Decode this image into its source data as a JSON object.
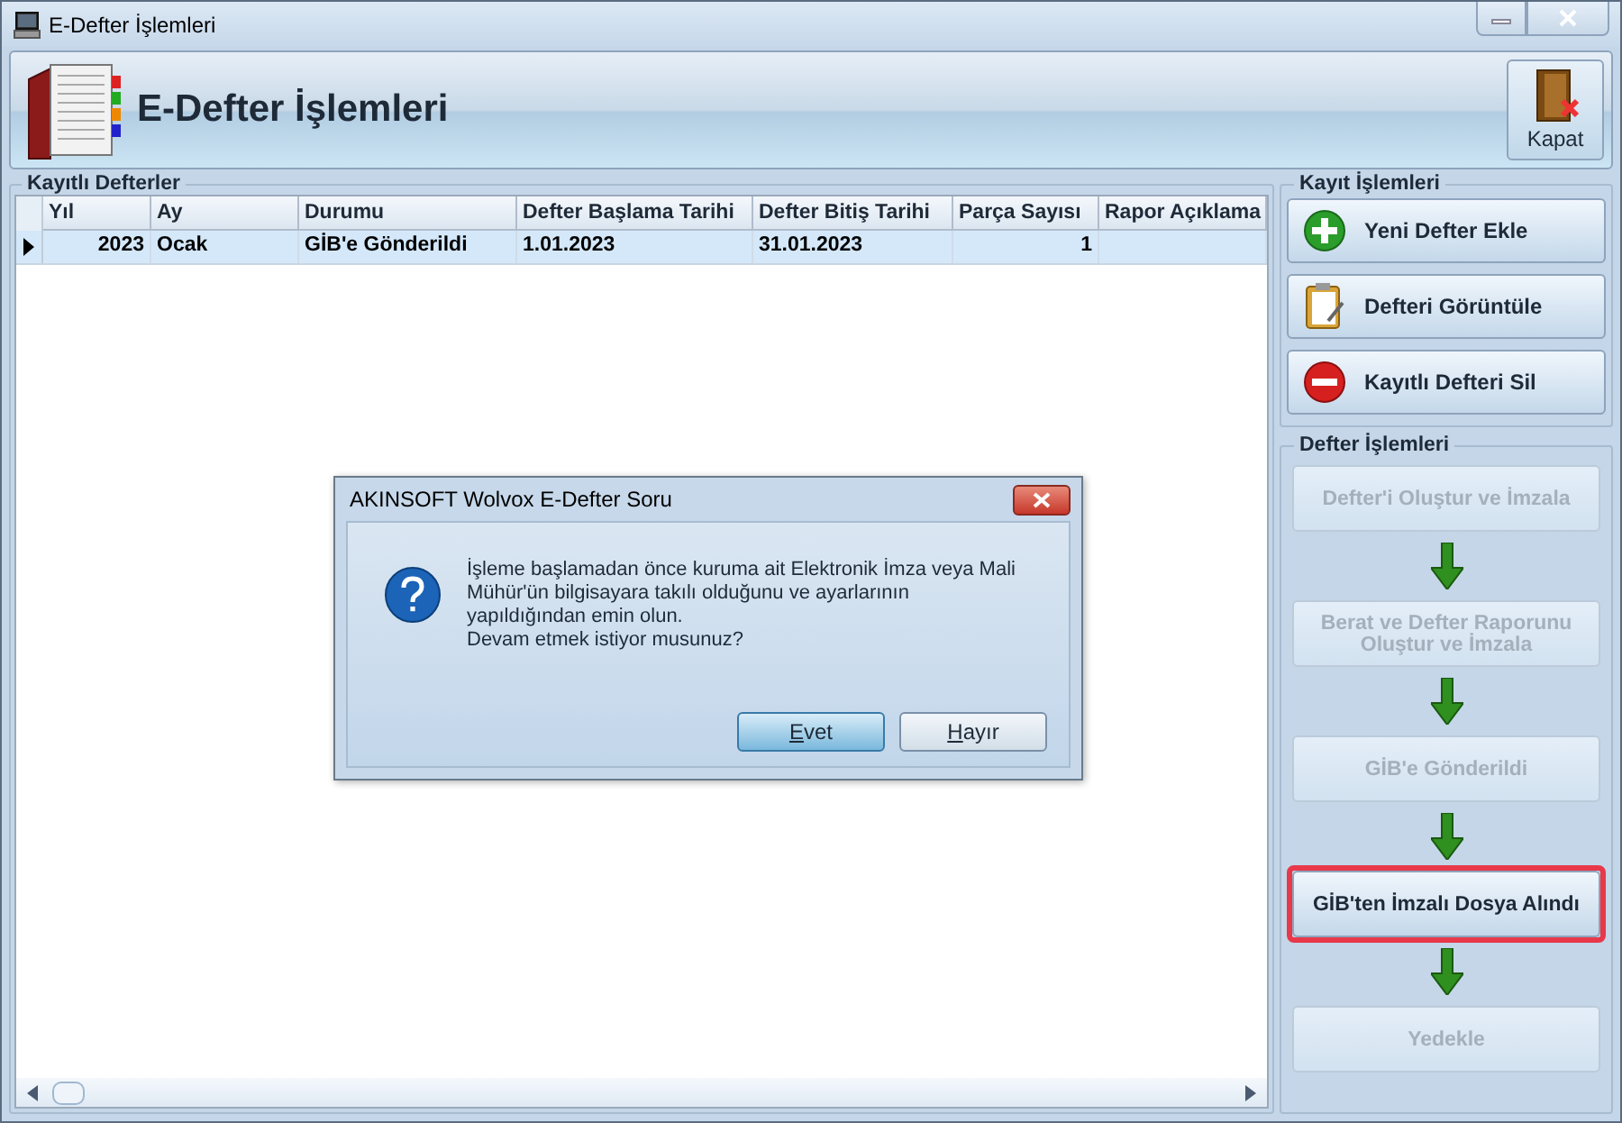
{
  "window": {
    "title": "E-Defter İşlemleri"
  },
  "header": {
    "title": "E-Defter İşlemleri",
    "close_button": "Kapat"
  },
  "records": {
    "title": "Kayıtlı Defterler",
    "columns": [
      "Yıl",
      "Ay",
      "Durumu",
      "Defter Başlama Tarihi",
      "Defter Bitiş Tarihi",
      "Parça Sayısı",
      "Rapor Açıklama"
    ],
    "rows": [
      {
        "cells": [
          "2023",
          "Ocak",
          "GİB'e Gönderildi",
          "1.01.2023",
          "31.01.2023",
          "1",
          ""
        ],
        "selected": true
      }
    ]
  },
  "record_actions": {
    "title": "Kayıt İşlemleri",
    "buttons": [
      {
        "label": "Yeni Defter Ekle",
        "kind": "add"
      },
      {
        "label": "Defteri Görüntüle",
        "kind": "view"
      },
      {
        "label": "Kayıtlı Defteri Sil",
        "kind": "delete"
      }
    ]
  },
  "ledger_actions": {
    "title": "Defter İşlemleri",
    "steps": [
      {
        "label": "Defter'i Oluştur ve İmzala",
        "disabled": true,
        "highlighted": false
      },
      {
        "label": "Berat ve Defter Raporunu Oluştur ve İmzala",
        "disabled": true,
        "highlighted": false
      },
      {
        "label": "GİB'e Gönderildi",
        "disabled": true,
        "highlighted": false
      },
      {
        "label": "GİB'ten İmzalı Dosya Alındı",
        "disabled": false,
        "highlighted": true
      },
      {
        "label": "Yedekle",
        "disabled": true,
        "highlighted": false
      }
    ]
  },
  "dialog": {
    "title": "AKINSOFT Wolvox E-Defter Soru",
    "message": "İşleme başlamadan önce kuruma ait Elektronik İmza veya Mali\nMühür'ün bilgisayara takılı olduğunu ve ayarlarının\nyapıldığından emin olun.\nDevam etmek istiyor musunuz?",
    "buttons": [
      {
        "label": "Evet",
        "selected": true
      },
      {
        "label": "Hayır",
        "selected": false
      }
    ]
  }
}
